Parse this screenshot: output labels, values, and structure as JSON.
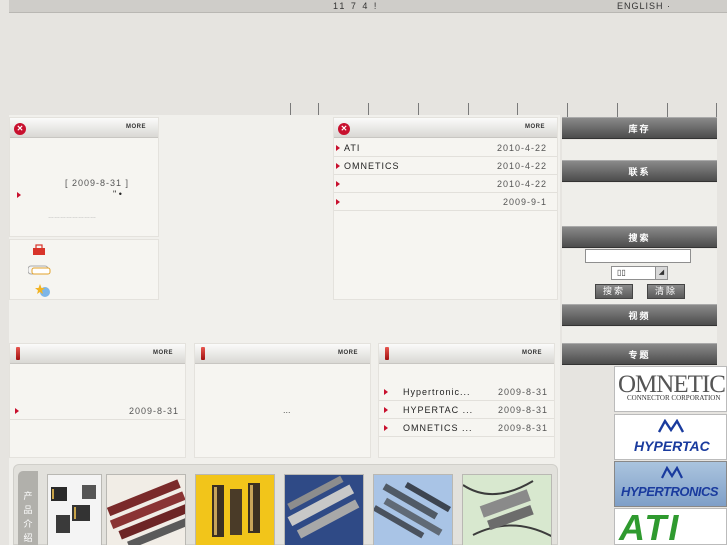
{
  "topbar": {
    "left_text": "11 7 4          !",
    "right_text": "ENGLISH  ·"
  },
  "nav": {
    "separators": 9
  },
  "panels": {
    "more_label": "MORE",
    "announcement": {
      "date": "[ 2009-8-31 ]",
      "marks": "\"   •",
      "dots": "……………………"
    },
    "news": {
      "rows": [
        {
          "title": "ATI",
          "date": "2010-4-22"
        },
        {
          "title": "OMNETICS",
          "date": "2010-4-22"
        },
        {
          "title": "",
          "date": "2010-4-22"
        },
        {
          "title": "",
          "date": "2009-9-1"
        }
      ]
    },
    "bottom_left": {
      "date": "2009-8-31"
    },
    "bottom_mid": {
      "ellipsis": "..."
    },
    "bottom_right": {
      "rows": [
        {
          "title": "Hypertronic...",
          "date": "2009-8-31"
        },
        {
          "title": "HYPERTAC ...",
          "date": "2009-8-31"
        },
        {
          "title": "OMNETICS ...",
          "date": "2009-8-31"
        }
      ]
    }
  },
  "sidebar": {
    "stock": "库存",
    "contact": "联系",
    "search": "搜索",
    "video": "视频",
    "topic": "专题",
    "search_box": {
      "value": "",
      "select_value": "▯▯",
      "search_btn": "搜索",
      "clear_btn": "清除"
    }
  },
  "logos": {
    "omnetics": {
      "name": "OMNETICS",
      "sub": "CONNECTOR CORPORATION"
    },
    "hypertac": {
      "name": "HYPERTAC"
    },
    "hypertronics": {
      "name": "HYPERTRONICS"
    },
    "ati": {
      "name": "ATI"
    }
  },
  "products": {
    "label": [
      "产",
      "品",
      "介",
      "绍"
    ]
  },
  "colors": {
    "accent_red": "#c8102e",
    "sidebar_dark": "#4c4c4c",
    "background": "#e6e4e0"
  }
}
